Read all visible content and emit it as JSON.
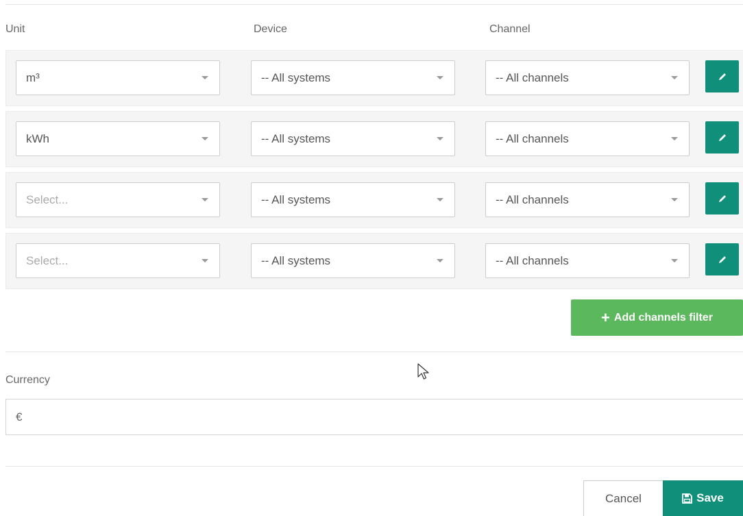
{
  "columns": {
    "unit": "Unit",
    "device": "Device",
    "channel": "Channel"
  },
  "filters": [
    {
      "unit": "m³",
      "unit_placeholder": false,
      "device": "-- All systems",
      "channel": "-- All channels"
    },
    {
      "unit": "kWh",
      "unit_placeholder": false,
      "device": "-- All systems",
      "channel": "-- All channels"
    },
    {
      "unit": "Select...",
      "unit_placeholder": true,
      "device": "-- All systems",
      "channel": "-- All channels"
    },
    {
      "unit": "Select...",
      "unit_placeholder": true,
      "device": "-- All systems",
      "channel": "-- All channels"
    }
  ],
  "icons": {
    "edit": "pencil-icon",
    "add": "plus-icon",
    "save": "floppy-disk-icon",
    "dropdown": "caret-down-icon",
    "cursor": "mouse-pointer-icon"
  },
  "add_filter_label": "Add channels filter",
  "currency": {
    "label": "Currency",
    "value": "€"
  },
  "actions": {
    "cancel": "Cancel",
    "save": "Save"
  },
  "colors": {
    "primary": "#10907a",
    "success": "#5cb85c",
    "row_bg": "#f5f5f5"
  }
}
